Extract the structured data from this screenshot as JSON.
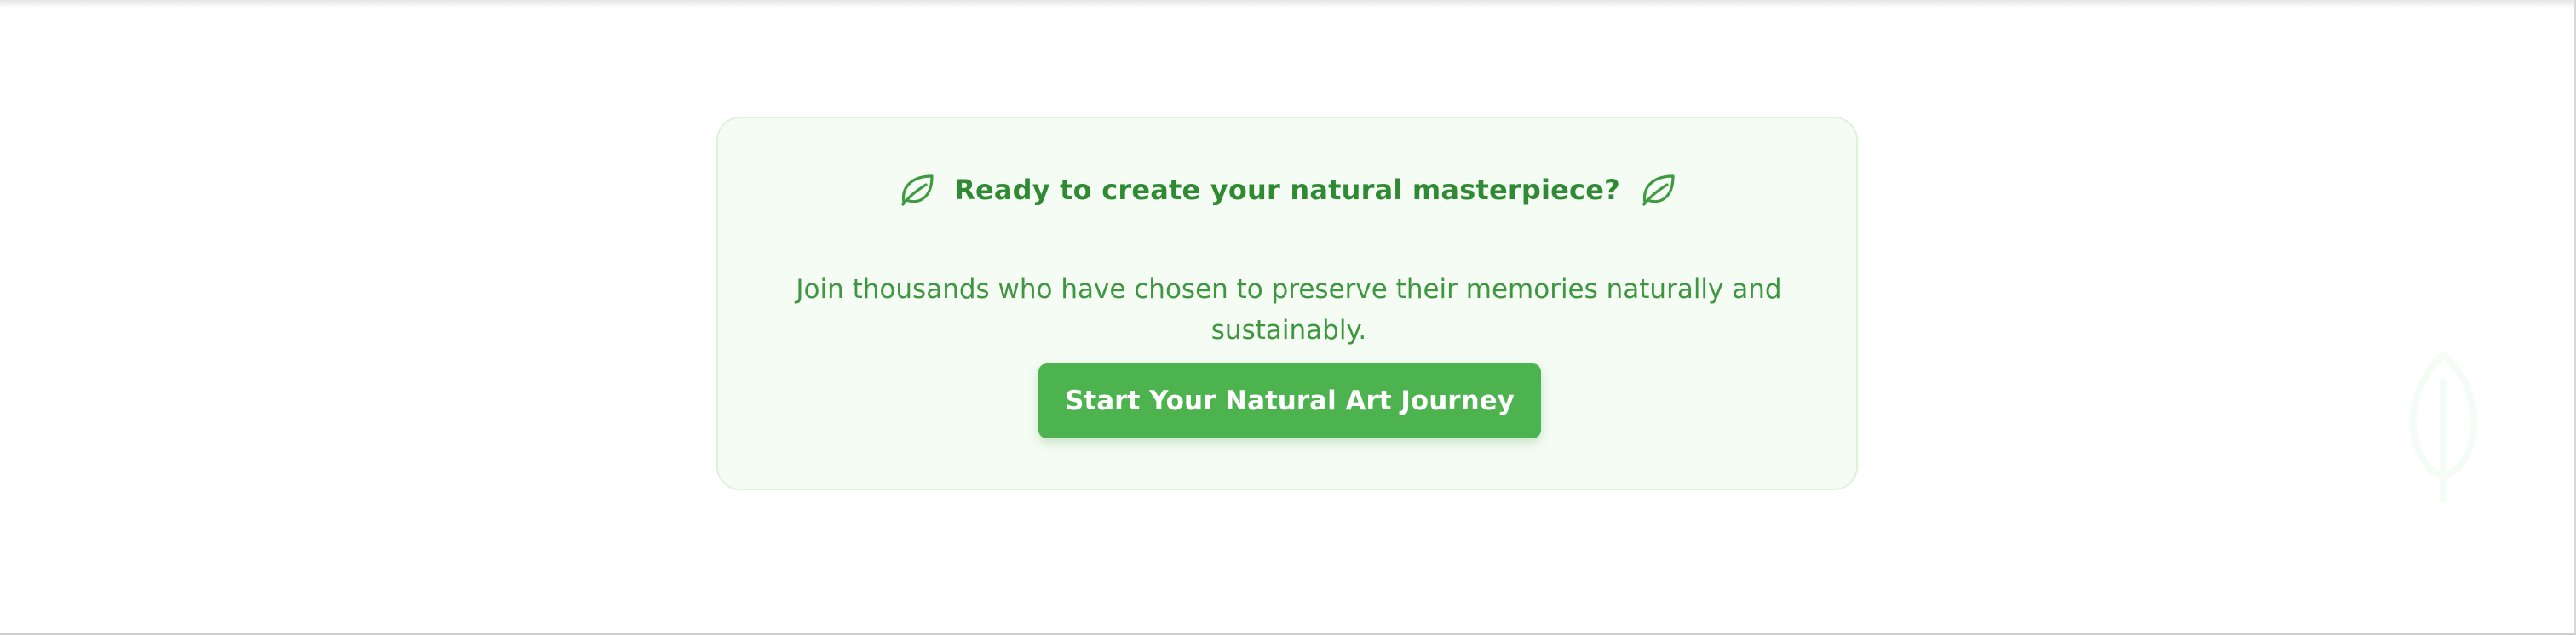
{
  "cta": {
    "title": "Ready to create your natural masterpiece?",
    "description": "Join thousands who have chosen to preserve their memories naturally and sustainably.",
    "button_label": "Start Your Natural Art Journey",
    "icons": {
      "title_left": "leaf-icon",
      "title_right": "leaf-icon",
      "decorative": "leaf-icon"
    }
  },
  "colors": {
    "card_background": "#f4fcf3",
    "card_border": "#dcf3da",
    "text_green": "#2f8a33",
    "button_green": "#4db34f",
    "button_text": "#ffffff"
  }
}
